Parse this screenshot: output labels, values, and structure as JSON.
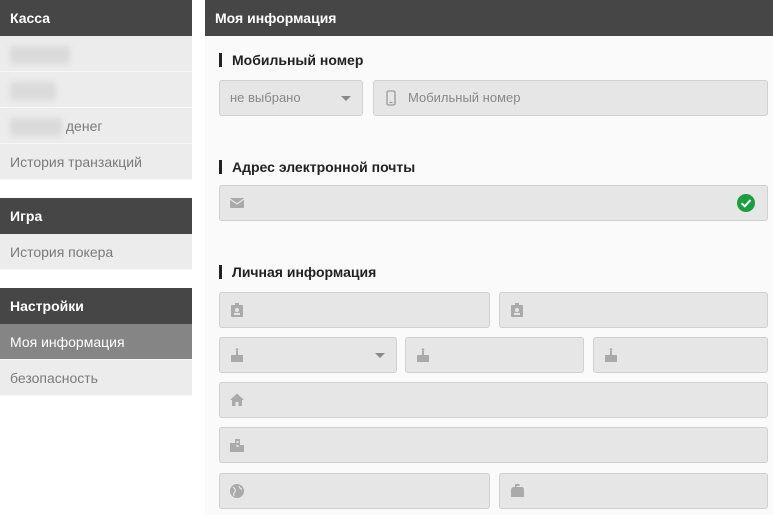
{
  "sidebar": {
    "cashier_header": "Касса",
    "money_suffix": "денег",
    "transactions": "История транзакций",
    "game_header": "Игра",
    "poker_history": "История покера",
    "settings_header": "Настройки",
    "my_info": "Моя информация",
    "security": "безопасность"
  },
  "main": {
    "title": "Моя информация",
    "mobile": {
      "title": "Мобильный номер",
      "country_select": "не выбрано",
      "placeholder": "Мобильный номер"
    },
    "email": {
      "title": "Адрес электронной почты",
      "verified": true
    },
    "personal": {
      "title": "Личная информация"
    }
  },
  "colors": {
    "header_bg": "#464646",
    "active_item": "#858585",
    "verified_green": "#1a9e3f"
  }
}
